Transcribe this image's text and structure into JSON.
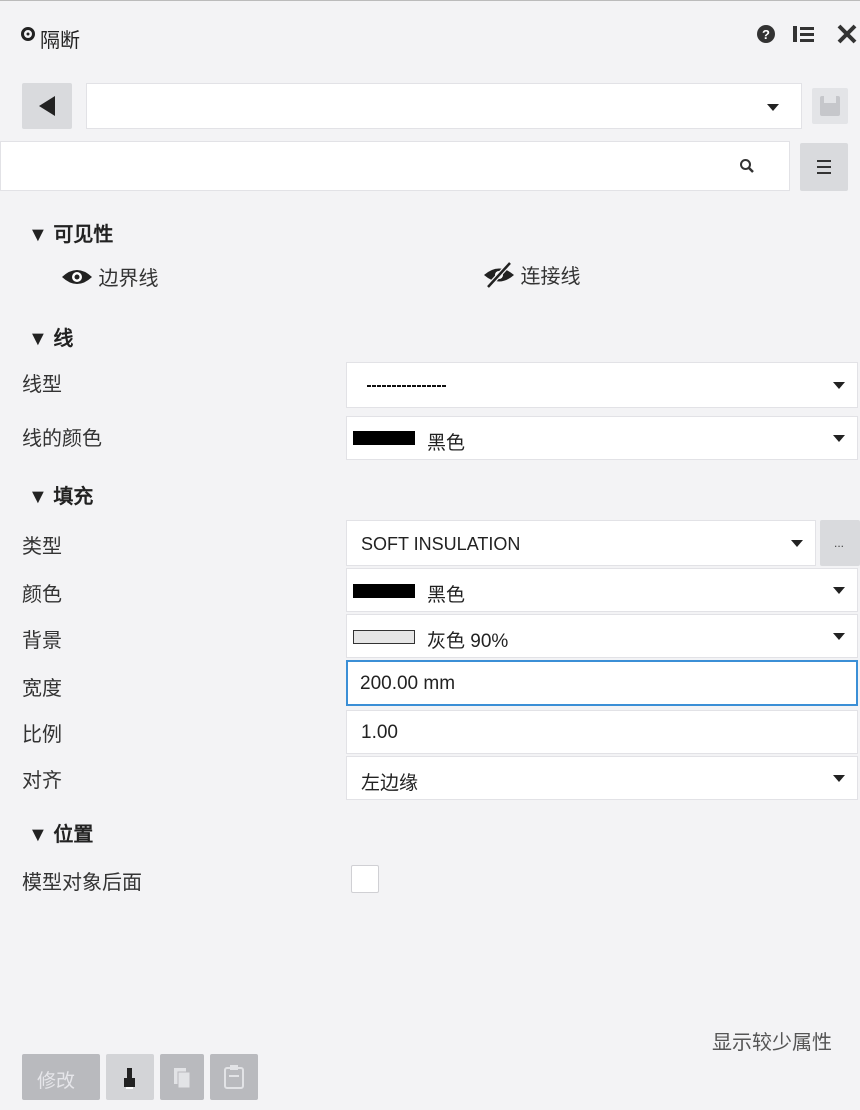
{
  "title": "隔断",
  "icons": {
    "settings": "gear-icon",
    "help": "help-icon",
    "list": "list-icon",
    "close": "close-icon",
    "back": "triangle-left-icon",
    "save": "save-icon",
    "search": "search-icon",
    "menu": "hamburger-icon",
    "eye": "eye-icon",
    "eye_off": "eye-off-icon"
  },
  "selector": {
    "value": ""
  },
  "search": {
    "value": "",
    "placeholder": ""
  },
  "visibility": {
    "title": "▼ 可见性",
    "boundary_label": "边界线",
    "connector_label": "连接线"
  },
  "line": {
    "title": "▼ 线",
    "type_label": "线型",
    "color_label": "线的颜色",
    "color_value": "黑色"
  },
  "fill": {
    "title": "▼ 填充",
    "type_label": "类型",
    "type_value": "SOFT INSULATION",
    "more_label": "...",
    "color_label": "颜色",
    "color_value": "黑色",
    "bg_label": "背景",
    "bg_value": "灰色 90%",
    "width_label": "宽度",
    "width_value": "200.00 mm",
    "scale_label": "比例",
    "scale_value": "1.00",
    "align_label": "对齐",
    "align_value": "左边缘"
  },
  "position": {
    "title": "▼ 位置",
    "behind_label": "模型对象后面",
    "behind_checked": false
  },
  "show_less": "显示较少属性",
  "bottom": {
    "modify_label": "修改"
  },
  "colors": {
    "swatch_black": "#000000",
    "swatch_gray90": "#e6e6e6",
    "focus_border": "#3b8fd6"
  }
}
